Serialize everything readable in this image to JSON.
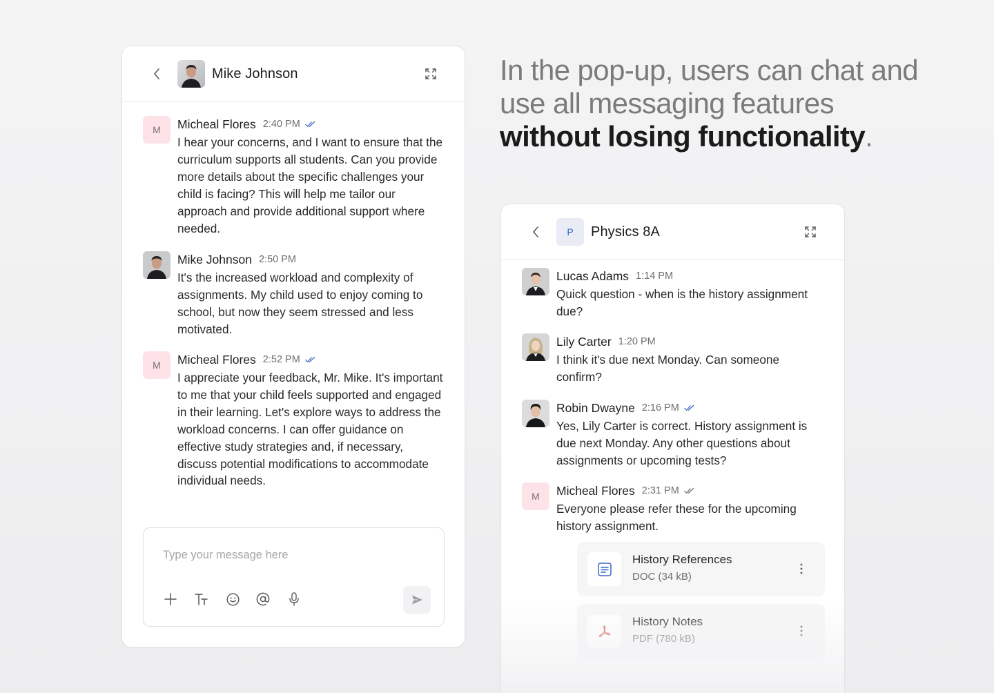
{
  "headline": {
    "line1": "In the pop-up, users can chat and",
    "line2": "use all messaging features",
    "line3_strong": "without losing functionality",
    "line3_end": "."
  },
  "left_chat": {
    "title": "Mike Johnson",
    "messages": [
      {
        "name": "Micheal Flores",
        "avatar_letter": "M",
        "time": "2:40 PM",
        "read": true,
        "text": "I hear your concerns, and I want to ensure that the curriculum supports all students. Can you provide more details about the specific challenges your child is facing? This will help me tailor our approach and provide additional support where needed."
      },
      {
        "name": "Mike Johnson",
        "time": "2:50 PM",
        "read": false,
        "text": "It's the increased workload and complexity of assignments. My child used to enjoy coming to school, but now they seem stressed and less motivated."
      },
      {
        "name": "Micheal Flores",
        "avatar_letter": "M",
        "time": "2:52 PM",
        "read": true,
        "text": "I appreciate your feedback, Mr. Mike. It's important to me that your child feels supported and engaged in their learning. Let's explore ways to address the workload concerns. I can offer guidance on effective study strategies and, if necessary, discuss potential modifications to accommodate individual needs."
      }
    ],
    "composer": {
      "placeholder": "Type your message here",
      "value": ""
    }
  },
  "right_chat": {
    "title": "Physics 8A",
    "avatar_letter": "P",
    "messages": [
      {
        "name": "Lucas Adams",
        "time": "1:14 PM",
        "read": false,
        "text": "Quick question - when is the history assignment due?"
      },
      {
        "name": "Lily Carter",
        "time": "1:20 PM",
        "read": false,
        "text": "I think it's due next Monday. Can someone confirm?"
      },
      {
        "name": "Robin Dwayne",
        "time": "2:16 PM",
        "read": true,
        "text": "Yes, Lily Carter is correct. History assignment is due next Monday. Any other questions about assignments or upcoming tests?"
      },
      {
        "name": "Micheal Flores",
        "avatar_letter": "M",
        "time": "2:31 PM",
        "read": true,
        "text": "Everyone please refer these for the upcoming history assignment."
      }
    ],
    "attachments": [
      {
        "name": "History References",
        "meta": "DOC (34 kB)",
        "icon": "document-icon"
      },
      {
        "name": "History Notes",
        "meta": "PDF (780 kB)",
        "icon": "pdf-icon"
      }
    ]
  },
  "colors": {
    "letter_avatar_bg": "#fde3e8",
    "check_blue": "#3a66c4",
    "pdf_red": "#d9534f",
    "doc_blue": "#3a66c4"
  }
}
